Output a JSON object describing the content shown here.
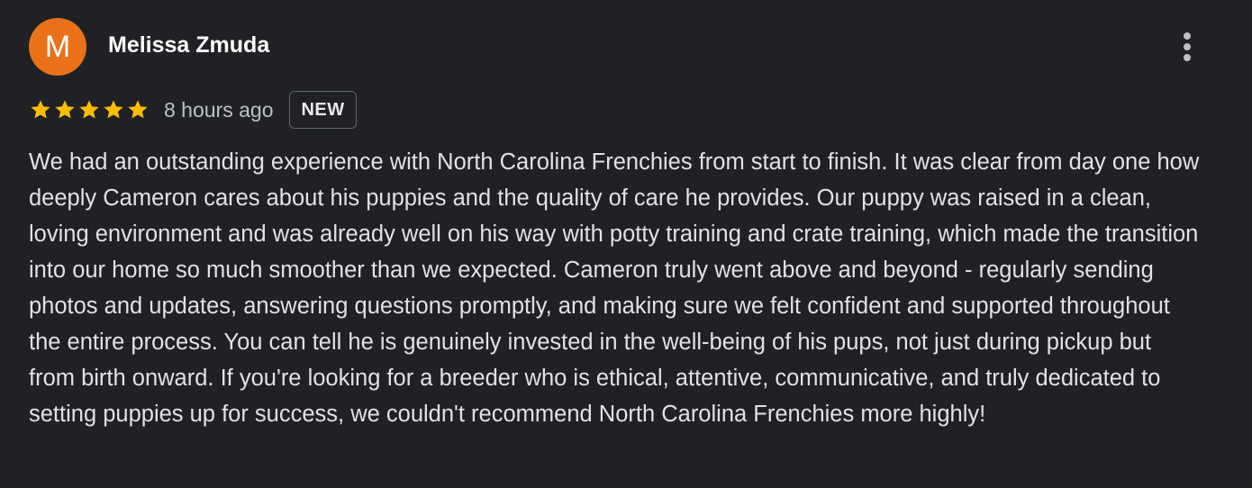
{
  "review": {
    "avatar_letter": "M",
    "author_name": "Melissa Zmuda",
    "rating": 5,
    "rating_max": 5,
    "time_ago": "8 hours ago",
    "badge_label": "NEW",
    "text": "We had an outstanding experience with North Carolina Frenchies from start to finish. It was clear from day one how deeply Cameron cares about his puppies and the quality of care he provides. Our puppy was raised in a clean, loving environment and was already well on his way with potty training and crate training, which made the transition into our home so much smoother than we expected. Cameron truly went above and beyond - regularly sending photos and updates, answering questions promptly, and making sure we felt confident and supported throughout the entire process. You can tell he is genuinely invested in the well-being of his pups, not just during pickup but from birth onward. If you're looking for a breeder who is ethical, attentive, communicative, and truly dedicated to setting puppies up for success, we couldn't recommend North Carolina Frenchies more highly!",
    "menu_icon": "more-vert-icon",
    "star_icon": "star-icon"
  },
  "colors": {
    "background": "#202124",
    "avatar_bg": "#e8711a",
    "star_fill": "#fbbc04",
    "badge_border": "#5f6368"
  }
}
